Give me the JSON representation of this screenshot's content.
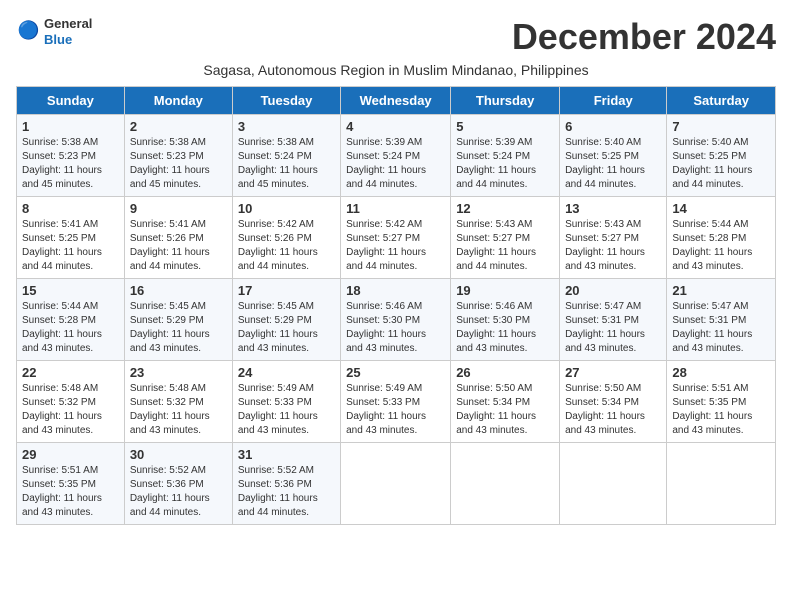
{
  "logo": {
    "line1": "General",
    "line2": "Blue"
  },
  "title": "December 2024",
  "subtitle": "Sagasa, Autonomous Region in Muslim Mindanao, Philippines",
  "days_header": [
    "Sunday",
    "Monday",
    "Tuesday",
    "Wednesday",
    "Thursday",
    "Friday",
    "Saturday"
  ],
  "weeks": [
    [
      {
        "day": "1",
        "sunrise": "5:38 AM",
        "sunset": "5:23 PM",
        "daylight": "11 hours and 45 minutes."
      },
      {
        "day": "2",
        "sunrise": "5:38 AM",
        "sunset": "5:23 PM",
        "daylight": "11 hours and 45 minutes."
      },
      {
        "day": "3",
        "sunrise": "5:38 AM",
        "sunset": "5:24 PM",
        "daylight": "11 hours and 45 minutes."
      },
      {
        "day": "4",
        "sunrise": "5:39 AM",
        "sunset": "5:24 PM",
        "daylight": "11 hours and 44 minutes."
      },
      {
        "day": "5",
        "sunrise": "5:39 AM",
        "sunset": "5:24 PM",
        "daylight": "11 hours and 44 minutes."
      },
      {
        "day": "6",
        "sunrise": "5:40 AM",
        "sunset": "5:25 PM",
        "daylight": "11 hours and 44 minutes."
      },
      {
        "day": "7",
        "sunrise": "5:40 AM",
        "sunset": "5:25 PM",
        "daylight": "11 hours and 44 minutes."
      }
    ],
    [
      {
        "day": "8",
        "sunrise": "5:41 AM",
        "sunset": "5:25 PM",
        "daylight": "11 hours and 44 minutes."
      },
      {
        "day": "9",
        "sunrise": "5:41 AM",
        "sunset": "5:26 PM",
        "daylight": "11 hours and 44 minutes."
      },
      {
        "day": "10",
        "sunrise": "5:42 AM",
        "sunset": "5:26 PM",
        "daylight": "11 hours and 44 minutes."
      },
      {
        "day": "11",
        "sunrise": "5:42 AM",
        "sunset": "5:27 PM",
        "daylight": "11 hours and 44 minutes."
      },
      {
        "day": "12",
        "sunrise": "5:43 AM",
        "sunset": "5:27 PM",
        "daylight": "11 hours and 44 minutes."
      },
      {
        "day": "13",
        "sunrise": "5:43 AM",
        "sunset": "5:27 PM",
        "daylight": "11 hours and 43 minutes."
      },
      {
        "day": "14",
        "sunrise": "5:44 AM",
        "sunset": "5:28 PM",
        "daylight": "11 hours and 43 minutes."
      }
    ],
    [
      {
        "day": "15",
        "sunrise": "5:44 AM",
        "sunset": "5:28 PM",
        "daylight": "11 hours and 43 minutes."
      },
      {
        "day": "16",
        "sunrise": "5:45 AM",
        "sunset": "5:29 PM",
        "daylight": "11 hours and 43 minutes."
      },
      {
        "day": "17",
        "sunrise": "5:45 AM",
        "sunset": "5:29 PM",
        "daylight": "11 hours and 43 minutes."
      },
      {
        "day": "18",
        "sunrise": "5:46 AM",
        "sunset": "5:30 PM",
        "daylight": "11 hours and 43 minutes."
      },
      {
        "day": "19",
        "sunrise": "5:46 AM",
        "sunset": "5:30 PM",
        "daylight": "11 hours and 43 minutes."
      },
      {
        "day": "20",
        "sunrise": "5:47 AM",
        "sunset": "5:31 PM",
        "daylight": "11 hours and 43 minutes."
      },
      {
        "day": "21",
        "sunrise": "5:47 AM",
        "sunset": "5:31 PM",
        "daylight": "11 hours and 43 minutes."
      }
    ],
    [
      {
        "day": "22",
        "sunrise": "5:48 AM",
        "sunset": "5:32 PM",
        "daylight": "11 hours and 43 minutes."
      },
      {
        "day": "23",
        "sunrise": "5:48 AM",
        "sunset": "5:32 PM",
        "daylight": "11 hours and 43 minutes."
      },
      {
        "day": "24",
        "sunrise": "5:49 AM",
        "sunset": "5:33 PM",
        "daylight": "11 hours and 43 minutes."
      },
      {
        "day": "25",
        "sunrise": "5:49 AM",
        "sunset": "5:33 PM",
        "daylight": "11 hours and 43 minutes."
      },
      {
        "day": "26",
        "sunrise": "5:50 AM",
        "sunset": "5:34 PM",
        "daylight": "11 hours and 43 minutes."
      },
      {
        "day": "27",
        "sunrise": "5:50 AM",
        "sunset": "5:34 PM",
        "daylight": "11 hours and 43 minutes."
      },
      {
        "day": "28",
        "sunrise": "5:51 AM",
        "sunset": "5:35 PM",
        "daylight": "11 hours and 43 minutes."
      }
    ],
    [
      {
        "day": "29",
        "sunrise": "5:51 AM",
        "sunset": "5:35 PM",
        "daylight": "11 hours and 43 minutes."
      },
      {
        "day": "30",
        "sunrise": "5:52 AM",
        "sunset": "5:36 PM",
        "daylight": "11 hours and 44 minutes."
      },
      {
        "day": "31",
        "sunrise": "5:52 AM",
        "sunset": "5:36 PM",
        "daylight": "11 hours and 44 minutes."
      },
      null,
      null,
      null,
      null
    ]
  ]
}
